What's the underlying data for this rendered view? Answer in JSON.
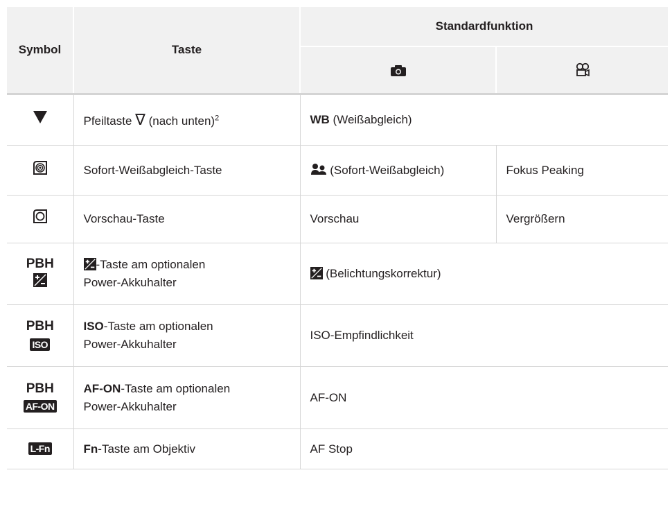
{
  "header": {
    "symbol": "Symbol",
    "taste": "Taste",
    "standardfunktion": "Standardfunktion",
    "photo_icon": "camera-icon",
    "movie_icon": "movie-camera-icon"
  },
  "rows": [
    {
      "symbol_icon": "down-triangle-icon",
      "taste_text": "Pfeiltaste",
      "taste_glyph": "∇",
      "taste_suffix": " (nach unten)",
      "taste_sup": "2",
      "function_bold": "WB",
      "function": " (Weißabgleich)"
    },
    {
      "symbol_icon": "one-touch-wb-button-icon",
      "taste": "Sofort-Weißabgleich-Taste",
      "photo_icon": "one-touch-wb-icon",
      "photo": " (Sofort-Weißabgleich)",
      "movie": "Fokus Peaking"
    },
    {
      "symbol_icon": "preview-button-icon",
      "taste": "Vorschau-Taste",
      "photo": "Vorschau",
      "movie": "Vergrößern"
    },
    {
      "symbol": "PBH",
      "symbol_icon": "exposure-compensation-icon",
      "taste_line1": "-Taste am optionalen",
      "taste_line2": "Power-Akkuhalter",
      "function_icon": "exposure-compensation-icon",
      "function": " (Belichtungskorrektur)"
    },
    {
      "symbol": "PBH",
      "symbol_badge": "ISO",
      "taste_bold": "ISO",
      "taste_line1": "-Taste am optionalen",
      "taste_line2": "Power-Akkuhalter",
      "function": "ISO-Empfindlichkeit"
    },
    {
      "symbol": "PBH",
      "symbol_badge": "AF-ON",
      "taste_bold": "AF-ON",
      "taste_line1": "-Taste am optionalen",
      "taste_line2": "Power-Akkuhalter",
      "function": "AF-ON"
    },
    {
      "symbol_badge": "L-Fn",
      "taste_bold": "Fn",
      "taste_line1": "-Taste am Objektiv",
      "function": "AF Stop"
    }
  ]
}
